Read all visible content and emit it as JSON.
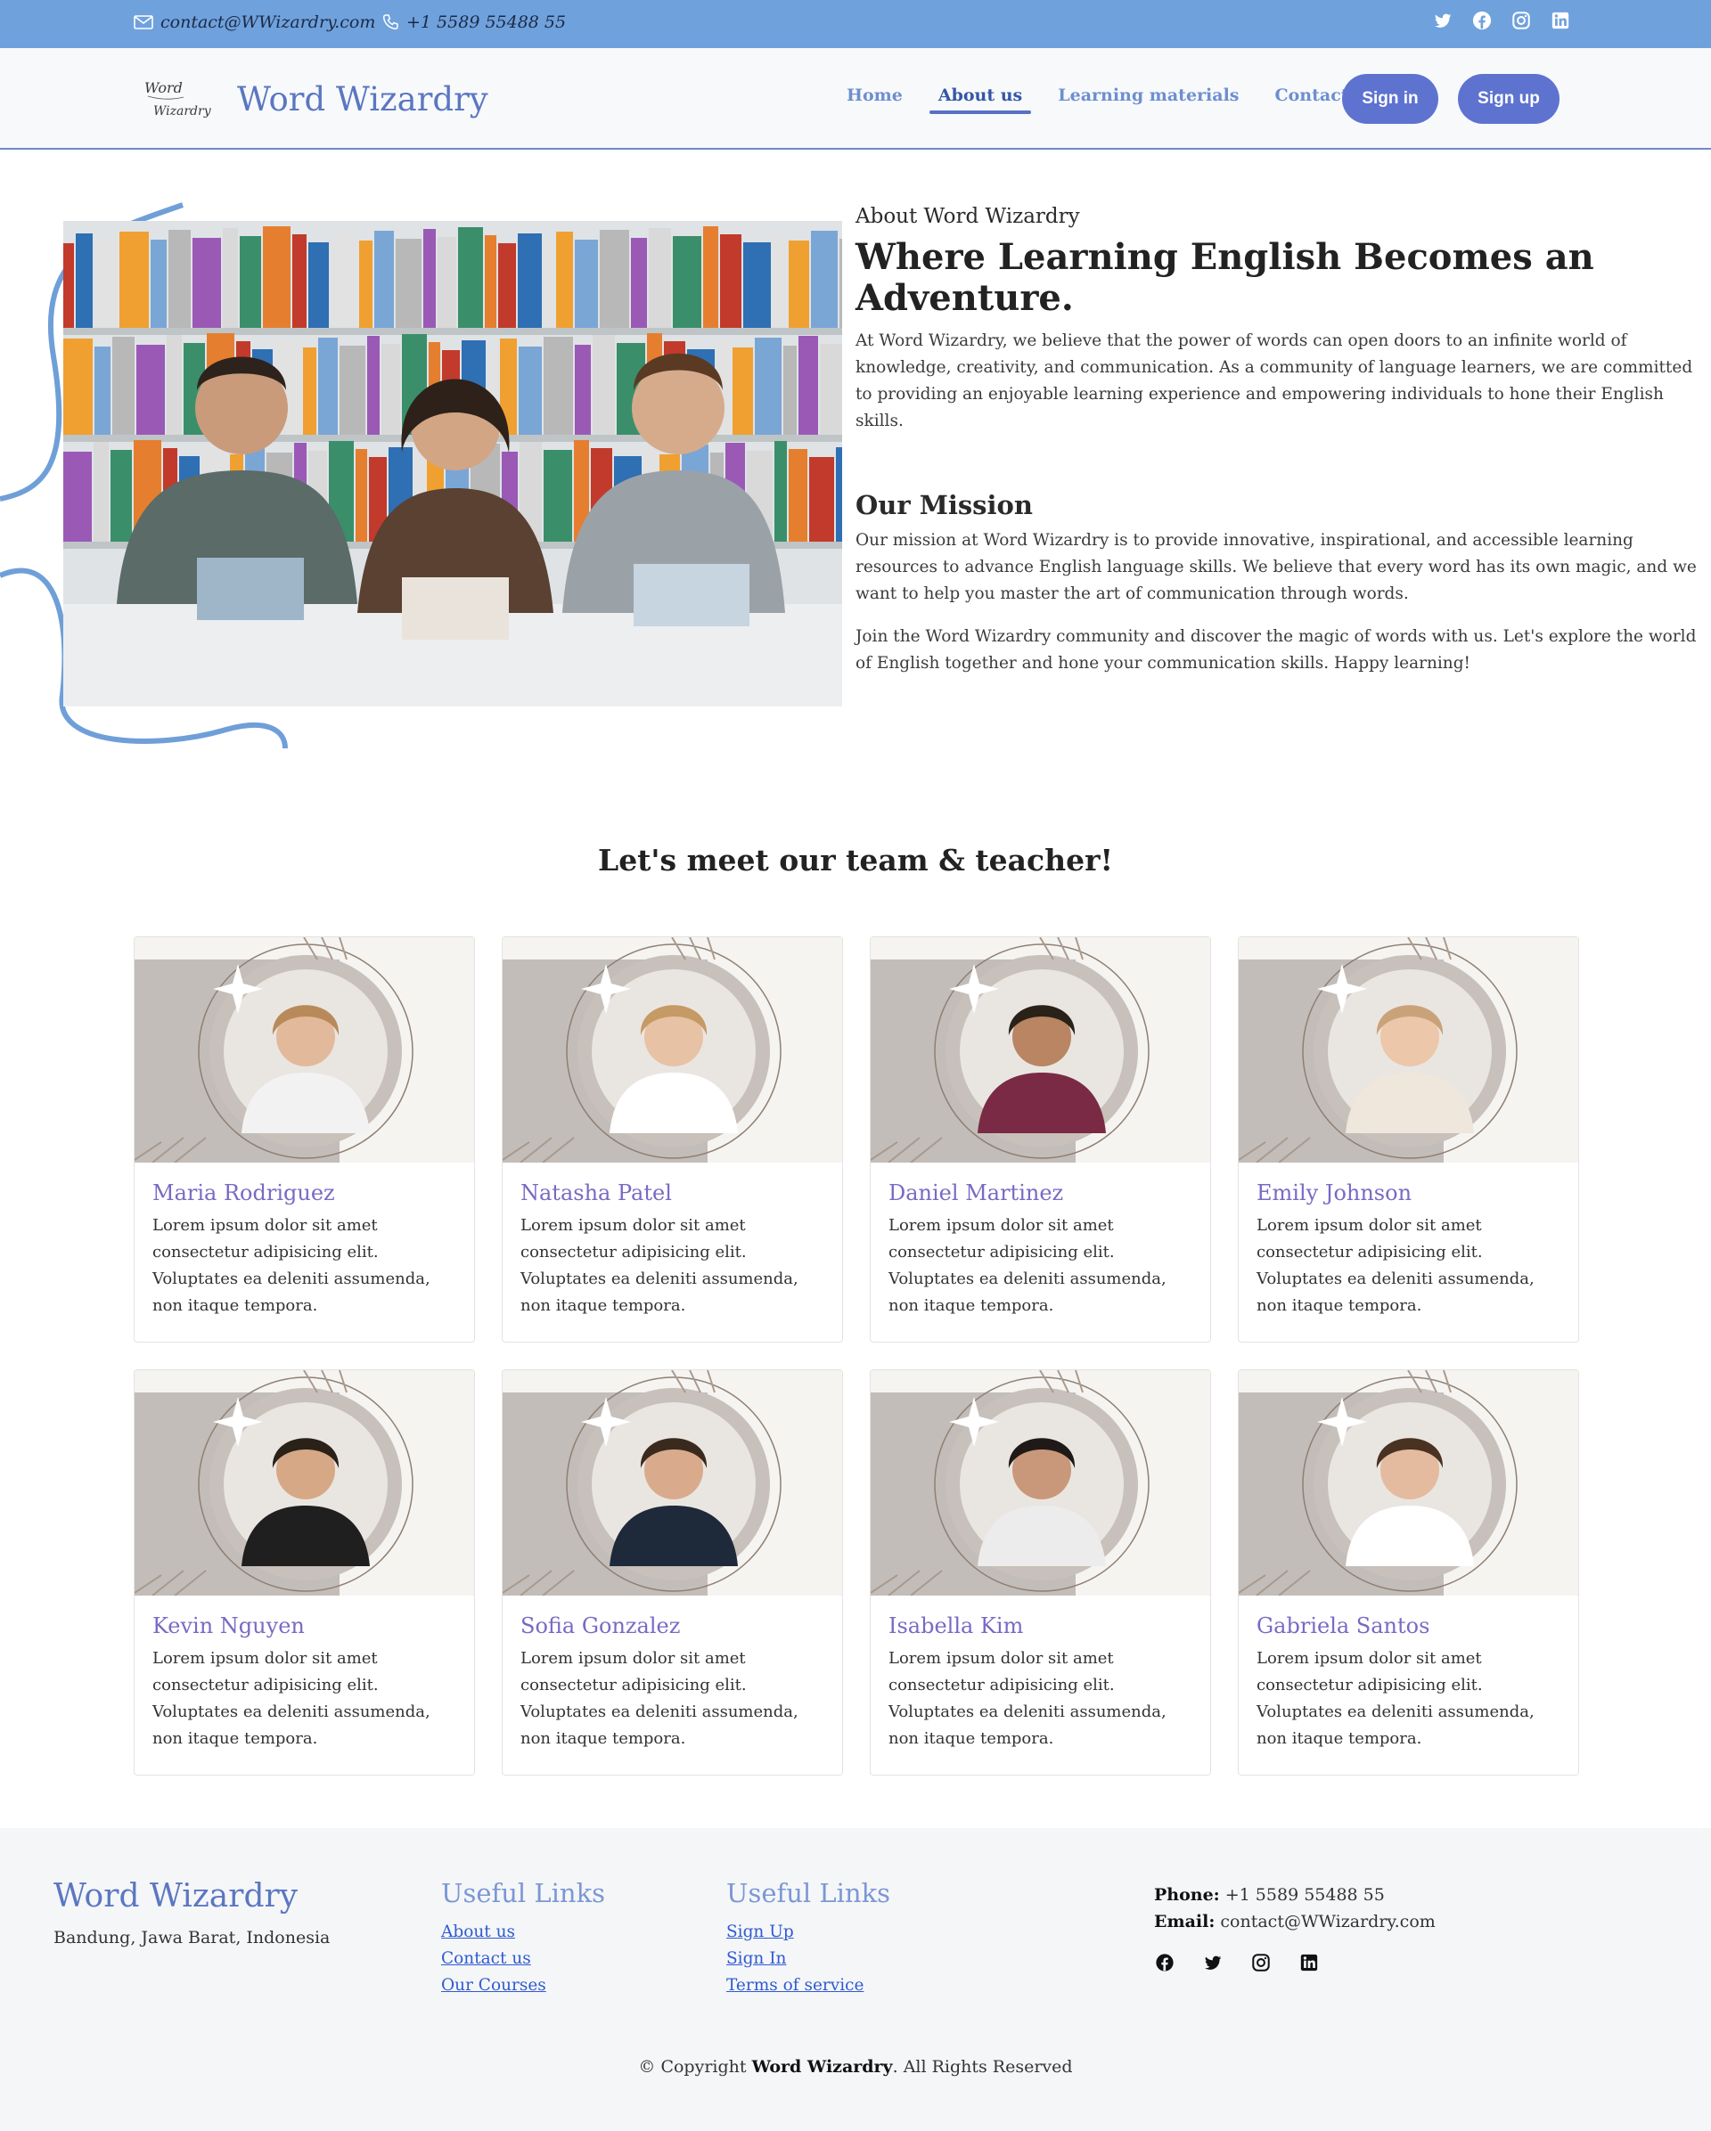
{
  "topbar": {
    "email": "contact@WWizardry.com",
    "phone": "+1 5589 55488 55",
    "socials": [
      "twitter-icon",
      "facebook-icon",
      "instagram-icon",
      "linkedin-icon"
    ],
    "bg_color": "#6fa1dd"
  },
  "header": {
    "logo_line1": "Word",
    "logo_line2": "Wizardry",
    "brand": "Word Wizardry",
    "nav": [
      {
        "label": "Home",
        "active": false
      },
      {
        "label": "About us",
        "active": true
      },
      {
        "label": "Learning materials",
        "active": false
      },
      {
        "label": "Contact us",
        "active": false
      }
    ],
    "sign_in": "Sign in",
    "sign_up": "Sign up",
    "accent_color": "#5e73d0"
  },
  "about": {
    "kicker": "About Word Wizardry",
    "title": "Where Learning English Becomes an Adventure.",
    "paragraph": "At Word Wizardry, we believe that the power of words can open doors to an infinite world of knowledge, creativity, and communication. As a community of language learners, we are committed to providing an enjoyable learning experience and empowering individuals to hone their English skills.",
    "mission_title": "Our Mission",
    "mission_p1": "Our mission at Word Wizardry is to provide innovative, inspirational, and accessible learning resources to advance English language skills. We believe that every word has its own magic, and we want to help you master the art of communication through words.",
    "mission_p2": "Join the Word Wizardry community and discover the magic of words with us. Let's explore the world of English together and hone your communication skills. Happy learning!"
  },
  "team": {
    "heading": "Let's meet our team & teacher!",
    "members": [
      {
        "name": "Maria Rodriguez",
        "text": "Lorem ipsum dolor sit amet consectetur adipisicing elit. Voluptates ea deleniti assumenda, non itaque tempora."
      },
      {
        "name": "Natasha Patel",
        "text": "Lorem ipsum dolor sit amet consectetur adipisicing elit. Voluptates ea deleniti assumenda, non itaque tempora."
      },
      {
        "name": "Daniel Martinez",
        "text": "Lorem ipsum dolor sit amet consectetur adipisicing elit. Voluptates ea deleniti assumenda, non itaque tempora."
      },
      {
        "name": "Emily Johnson",
        "text": "Lorem ipsum dolor sit amet consectetur adipisicing elit. Voluptates ea deleniti assumenda, non itaque tempora."
      },
      {
        "name": "Kevin Nguyen",
        "text": "Lorem ipsum dolor sit amet consectetur adipisicing elit. Voluptates ea deleniti assumenda, non itaque tempora."
      },
      {
        "name": "Sofia Gonzalez",
        "text": "Lorem ipsum dolor sit amet consectetur adipisicing elit. Voluptates ea deleniti assumenda, non itaque tempora."
      },
      {
        "name": "Isabella Kim",
        "text": "Lorem ipsum dolor sit amet consectetur adipisicing elit. Voluptates ea deleniti assumenda, non itaque tempora."
      },
      {
        "name": "Gabriela Santos",
        "text": "Lorem ipsum dolor sit amet consectetur adipisicing elit. Voluptates ea deleniti assumenda, non itaque tempora."
      }
    ]
  },
  "footer": {
    "brand": "Word Wizardry",
    "address": "Bandung, Jawa Barat, Indonesia",
    "col1_title": "Useful Links",
    "col1_links": [
      "About us",
      "Contact us",
      "Our Courses"
    ],
    "col2_title": "Useful Links",
    "col2_links": [
      "Sign Up",
      "Sign In",
      "Terms of service"
    ],
    "phone_label": "Phone:",
    "phone": "+1 5589 55488 55",
    "email_label": "Email:",
    "email": "contact@WWizardry.com",
    "socials": [
      "facebook-icon",
      "twitter-icon",
      "instagram-icon",
      "linkedin-icon"
    ],
    "copyright_prefix": "© Copyright",
    "copyright_brand": "Word Wizardry",
    "copyright_suffix": ". All Rights Reserved"
  }
}
